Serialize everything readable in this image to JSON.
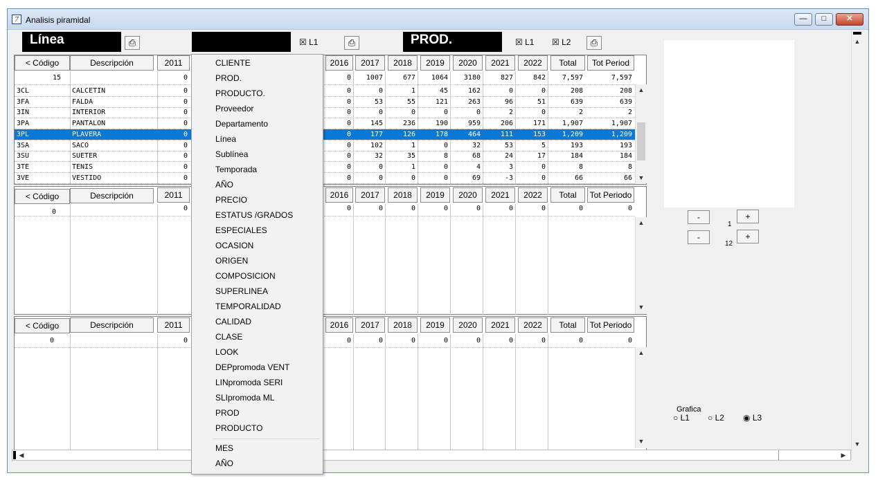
{
  "window": {
    "title": "Analisis piramidal",
    "icon": "app-icon"
  },
  "toolbar": {
    "linea_label": "Línea",
    "prod_label": "PROD.",
    "l1_label": "L1",
    "l2_label": "L2"
  },
  "headers": {
    "codigo": "< Código",
    "descripcion": "Descripción",
    "y2011": "2011",
    "y2016": "2016",
    "y2017": "2017",
    "y2018": "2018",
    "y2019": "2019",
    "y2020": "2020",
    "y2021": "2021",
    "y2022": "2022",
    "total": "Total",
    "tot_period_1": "Tot Period",
    "tot_period_2": "Tot Periodo"
  },
  "grid1": {
    "total_row": {
      "codigo": "15",
      "y2011": "0",
      "y2016": "0",
      "y2017": "1007",
      "y2018": "677",
      "y2019": "1064",
      "y2020": "3180",
      "y2021": "827",
      "y2022": "842",
      "total": "7,597",
      "tot_period": "7,597"
    },
    "rows": [
      {
        "codigo": "3CL",
        "desc": "CALCETIN",
        "y2011": "0",
        "y2016": "0",
        "y2017": "0",
        "y2018": "1",
        "y2019": "45",
        "y2020": "162",
        "y2021": "0",
        "y2022": "0",
        "total": "208",
        "tot_period": "208"
      },
      {
        "codigo": "3FA",
        "desc": "FALDA",
        "y2011": "0",
        "y2016": "0",
        "y2017": "53",
        "y2018": "55",
        "y2019": "121",
        "y2020": "263",
        "y2021": "96",
        "y2022": "51",
        "total": "639",
        "tot_period": "639"
      },
      {
        "codigo": "3IN",
        "desc": "INTERIOR",
        "y2011": "0",
        "y2016": "0",
        "y2017": "0",
        "y2018": "0",
        "y2019": "0",
        "y2020": "0",
        "y2021": "2",
        "y2022": "0",
        "total": "2",
        "tot_period": "2"
      },
      {
        "codigo": "3PA",
        "desc": "PANTALON",
        "y2011": "0",
        "y2016": "0",
        "y2017": "145",
        "y2018": "236",
        "y2019": "190",
        "y2020": "959",
        "y2021": "206",
        "y2022": "171",
        "total": "1,907",
        "tot_period": "1,907"
      },
      {
        "codigo": "3PL",
        "desc": "PLAVERA",
        "y2011": "0",
        "y2016": "0",
        "y2017": "177",
        "y2018": "126",
        "y2019": "178",
        "y2020": "464",
        "y2021": "111",
        "y2022": "153",
        "total": "1,209",
        "tot_period": "1,209"
      },
      {
        "codigo": "3SA",
        "desc": "SACO",
        "y2011": "0",
        "y2016": "0",
        "y2017": "102",
        "y2018": "1",
        "y2019": "0",
        "y2020": "32",
        "y2021": "53",
        "y2022": "5",
        "total": "193",
        "tot_period": "193"
      },
      {
        "codigo": "3SU",
        "desc": "SUETER",
        "y2011": "0",
        "y2016": "0",
        "y2017": "32",
        "y2018": "35",
        "y2019": "8",
        "y2020": "68",
        "y2021": "24",
        "y2022": "17",
        "total": "184",
        "tot_period": "184"
      },
      {
        "codigo": "3TE",
        "desc": "TENIS",
        "y2011": "0",
        "y2016": "0",
        "y2017": "0",
        "y2018": "1",
        "y2019": "0",
        "y2020": "4",
        "y2021": "3",
        "y2022": "0",
        "total": "8",
        "tot_period": "8"
      },
      {
        "codigo": "3VE",
        "desc": "VESTIDO",
        "y2011": "0",
        "y2016": "0",
        "y2017": "0",
        "y2018": "0",
        "y2019": "0",
        "y2020": "69",
        "y2021": "-3",
        "y2022": "0",
        "total": "66",
        "tot_period": "66"
      }
    ]
  },
  "grid2": {
    "total_row": {
      "codigo": "0",
      "y2011": "0",
      "y2016": "0",
      "y2017": "0",
      "y2018": "0",
      "y2019": "0",
      "y2020": "0",
      "y2021": "0",
      "y2022": "0",
      "total": "0",
      "tot_period": "0"
    }
  },
  "grid3": {
    "total_row": {
      "codigo": "0",
      "y2011": "0",
      "y2016": "0",
      "y2017": "0",
      "y2018": "0",
      "y2019": "0",
      "y2020": "0",
      "y2021": "0",
      "y2022": "0",
      "total": "0",
      "tot_period": "0"
    }
  },
  "menu": {
    "items": [
      "CLIENTE",
      "PROD.",
      "PRODUCTO.",
      "Proveedor",
      "Departamento",
      "Línea",
      "Sublínea",
      "Temporada",
      "AÑO",
      "PRECIO",
      "ESTATUS /GRADOS",
      "ESPECIALES",
      "OCASION",
      "ORIGEN",
      "COMPOSICION",
      "SUPERLINEA",
      "TEMPORALIDAD",
      "CALIDAD",
      "CLASE",
      "LOOK",
      "DEPpromoda VENT",
      "LINpromoda SERI",
      "SLIpromoda ML",
      "PROD",
      "PRODUCTO"
    ],
    "items2": [
      "MES",
      "AÑO"
    ]
  },
  "spinners": {
    "minus": "-",
    "plus": "+",
    "value1": "1",
    "value2": "12"
  },
  "grafica": {
    "label": "Grafica",
    "opt1": "L1",
    "opt2": "L2",
    "opt3": "L3",
    "selected": "L3"
  },
  "colors": {
    "selection": "#0a78d7",
    "title_bg": "#dbe7f5"
  }
}
